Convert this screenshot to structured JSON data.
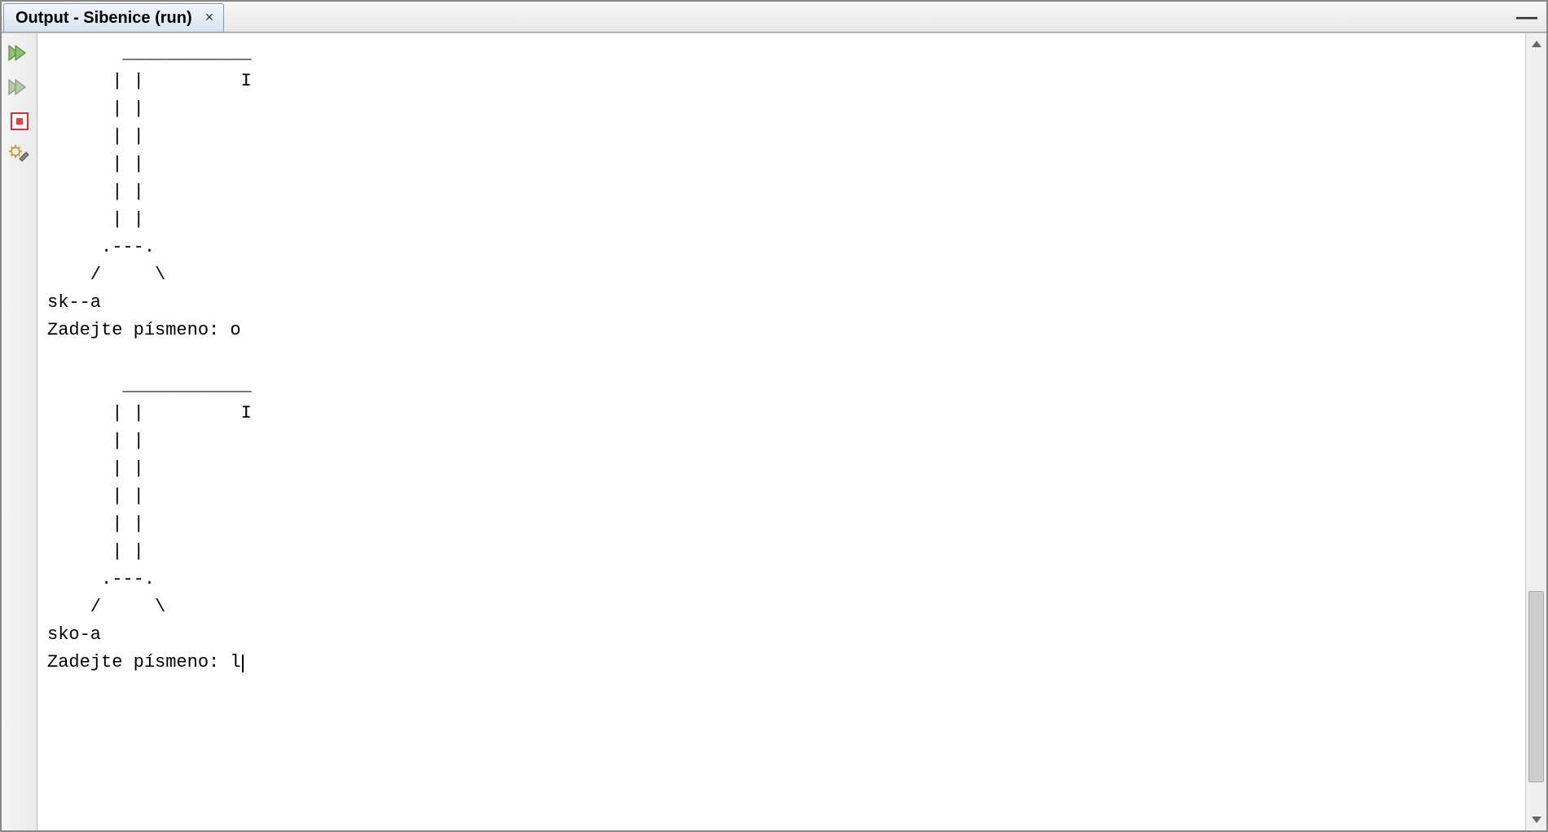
{
  "tab": {
    "title": "Output - Sibenice (run)",
    "close_label": "×"
  },
  "window": {
    "minimize_glyph": "—"
  },
  "toolbar": {
    "run_name": "rerun-button",
    "rerun_name": "rerun-alt-button",
    "stop_name": "stop-button",
    "tools_name": "settings-button"
  },
  "console": {
    "lines": [
      "       ____________",
      "      | |         I",
      "      | |",
      "      | |",
      "      | |",
      "      | |",
      "      | |",
      "     .---.",
      "    /     \\",
      "sk--a",
      "Zadejte písmeno: o",
      "",
      "       ____________",
      "      | |         I",
      "      | |",
      "      | |",
      "      | |",
      "      | |",
      "      | |",
      "     .---.",
      "    /     \\",
      "sko-a",
      "Zadejte písmeno: l"
    ]
  },
  "scrollbar": {
    "thumb_top_pct": 70,
    "thumb_height_pct": 24
  }
}
